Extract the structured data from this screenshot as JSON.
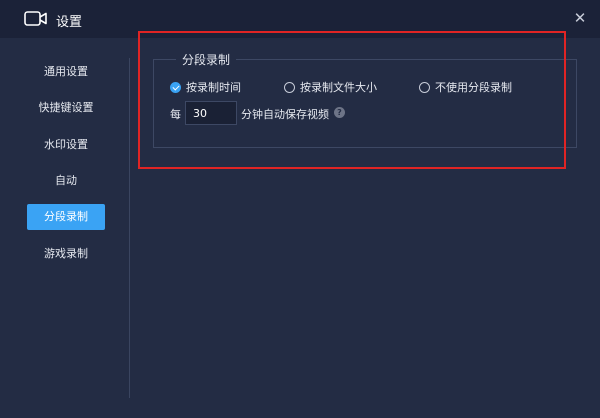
{
  "window": {
    "title": "设置",
    "close_glyph": "✕",
    "icon": "video-camera-icon"
  },
  "sidebar": {
    "items": [
      {
        "label": "通用设置",
        "active": false
      },
      {
        "label": "快捷键设置",
        "active": false
      },
      {
        "label": "水印设置",
        "active": false
      },
      {
        "label": "自动",
        "active": false
      },
      {
        "label": "分段录制",
        "active": true
      },
      {
        "label": "游戏录制",
        "active": false
      }
    ]
  },
  "segment_recording": {
    "legend": "分段录制",
    "options": [
      {
        "label": "按录制时间",
        "selected": true
      },
      {
        "label": "按录制文件大小",
        "selected": false
      },
      {
        "label": "不使用分段录制",
        "selected": false
      }
    ],
    "every_label": "每",
    "minutes_value": "30",
    "auto_save_label": "分钟自动保存视频",
    "help_glyph": "?"
  },
  "colors": {
    "background": "#232c44",
    "titlebar": "#1b2238",
    "accent": "#3aa3f4",
    "highlight_border": "#e02424"
  }
}
